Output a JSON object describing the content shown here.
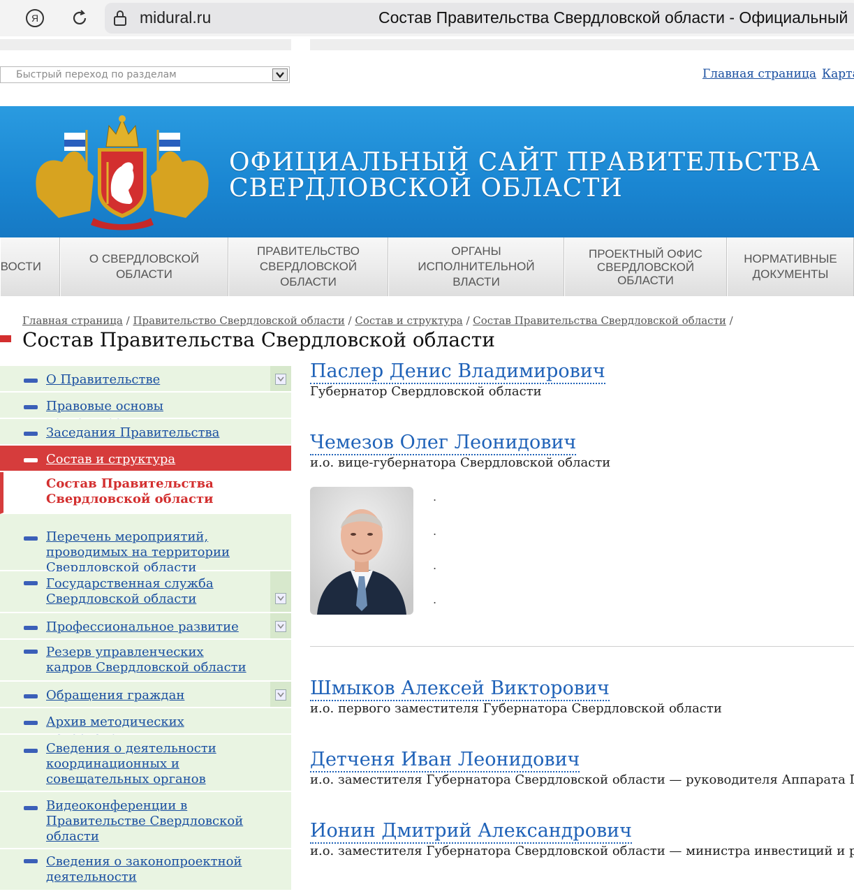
{
  "browser": {
    "url": "midural.ru",
    "title": "Состав Правительства Свердловской области - Официальный"
  },
  "quicknav": {
    "placeholder": "Быстрый переход по разделам"
  },
  "toplinks": [
    "Главная страница",
    "Карта"
  ],
  "banner": {
    "line1": "ОФИЦИАЛЬНЫЙ САЙТ ПРАВИТЕЛЬСТВА",
    "line2": "СВЕРДЛОВСКОЙ ОБЛАСТИ",
    "colors": {
      "top": "#2a9be0",
      "bottom": "#1679c4"
    }
  },
  "mainnav": [
    "ВОСТИ",
    "О СВЕРДЛОВСКОЙ ОБЛАСТИ",
    "ПРАВИТЕЛЬСТВО СВЕРДЛОВСКОЙ ОБЛАСТИ",
    "ОРГАНЫ ИСПОЛНИТЕЛЬНОЙ ВЛАСТИ",
    "ПРОЕКТНЫЙ ОФИС СВЕРДЛОВСКОЙ ОБЛАСТИ",
    "НОРМАТИВНЫЕ ДОКУМЕНТЫ"
  ],
  "breadcrumb": [
    "Главная страница",
    "Правительство Свердловской области",
    "Состав и структура",
    "Состав Правительства Свердловской области"
  ],
  "heading": "Состав Правительства Свердловской области",
  "sidebar": [
    {
      "label": "О Правительстве",
      "expander": true
    },
    {
      "label": "Правовые основы деятельности"
    },
    {
      "label": "Заседания Правительства"
    },
    {
      "label": "Состав и структура",
      "active": true
    },
    {
      "label": "Состав Правительства Свердловской области",
      "sub": true
    },
    {
      "label": "Перечень мероприятий, проводимых на территории Свердловской области"
    },
    {
      "label": "Государственная служба Свердловской области",
      "expander": true
    },
    {
      "label": "Профессиональное развитие",
      "expander": true
    },
    {
      "label": "Резерв управленческих кадров Свердловской области"
    },
    {
      "label": "Обращения граждан",
      "expander": true
    },
    {
      "label": "Архив методических материалов"
    },
    {
      "label": "Сведения о деятельности координационных и совещательных органов"
    },
    {
      "label": "Видеоконференции в Правительстве Свердловской области"
    },
    {
      "label": "Сведения о законопроектной деятельности"
    }
  ],
  "people": [
    {
      "name": "Паслер Денис Владимирович",
      "role": "Губернатор Свердловской области"
    },
    {
      "name": "Чемезов Олег Леонидович",
      "role": "и.о. вице-губернатора Свердловской области"
    },
    {
      "name": "Шмыков Алексей Викторович",
      "role": "и.о. первого заместителя Губернатора Свердловской области"
    },
    {
      "name": "Детченя Иван Леонидович",
      "role": "и.о. заместителя Губернатора Свердловской области — руководителя Аппарата Губерн"
    },
    {
      "name": "Ионин Дмитрий Александрович",
      "role": "и.о. заместителя Губернатора Свердловской области — министра инвестиций и развит"
    }
  ],
  "dots": [
    ".",
    ".",
    ".",
    "."
  ],
  "accent": {
    "red": "#d63c3c",
    "link": "#1f62b8",
    "sidebar_bg": "#e9f4e2"
  }
}
